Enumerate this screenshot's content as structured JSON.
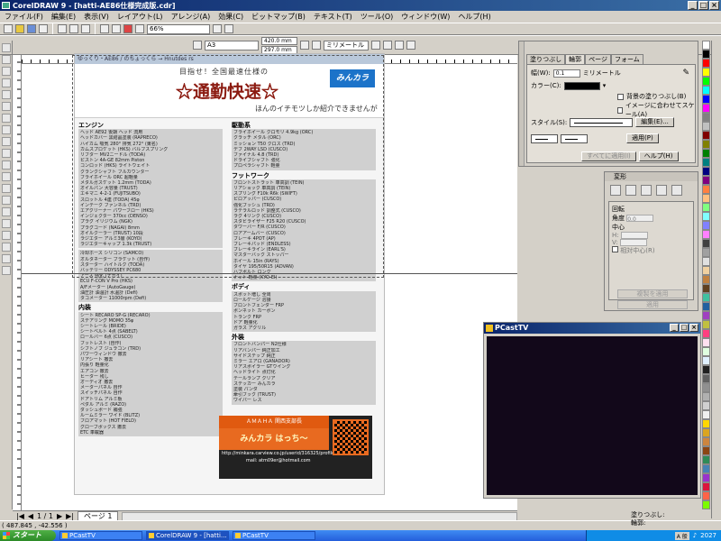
{
  "window": {
    "title": "CorelDRAW 9 - [hatti-AE86仕様完成版.cdr]"
  },
  "menubar": [
    "ファイル(F)",
    "編集(E)",
    "表示(V)",
    "レイアウト(L)",
    "アレンジ(A)",
    "効果(C)",
    "ビットマップ(B)",
    "テキスト(T)",
    "ツール(O)",
    "ウィンドウ(W)",
    "ヘルプ(H)"
  ],
  "toolbar": {
    "zoom": "66%",
    "paper_size": "A3",
    "width": "420.0 mm",
    "height": "297.0 mm",
    "units": "ミリメートル"
  },
  "doc": {
    "top_url": "ゆっくり・AE86 / のちょっくら → Hnutdes rs",
    "tagline": "目指せ！全国最速仕様の",
    "title": "☆通勤快速☆",
    "logo": "みんカラ",
    "subline": "ほんのイチモツしか紹介できませんが",
    "left_sections": [
      {
        "heading": "エンジン",
        "lines": [
          "ヘッド AE92 後期 ヘッド 流用",
          "ヘッドカバー 黒結晶塗装 (RAPRECO)",
          "ハイカム 吸気 280° 排気 272° (東名)",
          "カムスプロケット (HKS) バルブスプリング",
          "リフター MV2ニードル (TODA)",
          "ピストン 4A-GE 82mm Piston",
          "コンロッド (HKS) ライトウェイト",
          "クランクシャフト フルカウンター",
          "フライホイール ORC 超軽量",
          "メタルガスケット 1.2mm (TODA)",
          "オイルパン 大容量 (TRUST)",
          "エキマニ 4-2-1 (FUJITSUBO)",
          "スロットル 4連 (TODA) 45φ",
          "インテーク ファンネル (TRD)",
          "エアクリーナー パワーフロー (HKS)",
          "インジェクター 370cc (DENSO)",
          "プラグ イリジウム (NGK)",
          "プラグコード (NAGAI) 8mm",
          "オイルクーラー (TRUST) 10段",
          "ラジエター アルミ3層 (KOYO)",
          "ラジエターキャップ 1.3k (TRUST)"
        ]
      },
      {
        "heading": "",
        "lines": [
          "冷却ホース シリコン (SAMCO)",
          "オルタネーター ブラケット (自作)",
          "スターター ハイトルク (TODA)",
          "バッテリー ODYSSEY PC680",
          "アース 強化 (ナガイ)",
          "ECU F-CON V Pro (HKS)",
          "A/Fメーター (AutoGauge)",
          "油圧計 油温計 水温計 (Defi)",
          "タコメーター 11000rpm (Defi)"
        ]
      },
      {
        "heading": "内装",
        "lines": [
          "シート RECARO SP-G (RECARO)",
          "ステアリング MOMO 35φ",
          "シートレール (BRIDE)",
          "シートベルト 4点 (SABELT)",
          "ロールバー 6点 (CUSCO)",
          "フットレスト (自作)",
          "シフトノブ ジュラコン (TRD)",
          "パワーウィンドウ 撤去",
          "リアシート 撤去",
          "内張り 軽量化",
          "エアコン 撤去",
          "ヒーター 残し",
          "オーディオ 撤去",
          "メーターパネル 自作",
          "スイッチパネル 自作",
          "ドアトリム アルミ板",
          "ペダル アルミ (RAZO)",
          "ダッシュボード 補強",
          "ルームミラー ワイド (BLITZ)",
          "フロアマット (HOT FIELD)",
          "グローブボックス 撤去",
          "ETC 車載器"
        ]
      }
    ],
    "right_sections": [
      {
        "heading": "駆動系",
        "lines": [
          "フライホイール クロモリ 4.9kg (ORC)",
          "クラッチ メタル (ORC)",
          "ミッション T50 クロス (TRD)",
          "デフ 2WAY LSD (CUSCO)",
          "ファイナル 4.8 (TRD)",
          "ドライブシャフト 強化",
          "プロペラシャフト 軽量"
        ]
      },
      {
        "heading": "フットワーク",
        "lines": [
          "フロントストラット 車高調 (TEIN)",
          "リアショック 車高調 (TEIN)",
          "スプリング F10k R6k (SWIFT)",
          "ピロアッパー (CUSCO)",
          "強化ブッシュ (TRD)",
          "ラテラルロッド 調整式 (CUSCO)",
          "ラグ 4リンク (CUSCO)",
          "スタビライザー F25 R20 (CUSCO)",
          "タワーバー F/R (CUSCO)",
          "ロアアームバー (CUSCO)",
          "ブレーキ 4POT (AP)",
          "ブレーキパッド (ENDLESS)",
          "ブレーキライン (EARL'S)",
          "マスターバック ストッパー",
          "ホイール 15in (RAYS)",
          "タイヤ 195/50R15 (ADVAN)",
          "ハブボルト ロング",
          "ナット 軽量 (KYO-EI)"
        ]
      },
      {
        "heading": "ボディ",
        "lines": [
          "スポット増し 全周",
          "ロールケージ 溶接",
          "フロントフェンダー FRP",
          "ボンネット カーボン",
          "トランク FRP",
          "ドア 軽量化",
          "ガラス アクリル"
        ]
      },
      {
        "heading": "外装",
        "lines": [
          "フロントバンパー N2仕様",
          "リアバンパー 純正加工",
          "サイドステップ 純正",
          "ミラー エアロ (GANADOR)",
          "リアスポイラー GTウイング",
          "ヘッドライト 点灯化",
          "テールランプ クリア",
          "ステッカー みんカラ",
          "塗装 パンダ",
          "牽引フック (TRUST)",
          "ワイパー レス"
        ]
      }
    ],
    "ad": {
      "top": "ＡＭＡＨＡ 関西支部長",
      "mid": "みんカラ はっち～",
      "url": "http://minkara.carview.co.jp/userid/316325/profile/",
      "mail": "mail: atm09er@hotmail.com"
    }
  },
  "docker": {
    "tabs": [
      "塗りつぶし",
      "輪郭",
      "ページ",
      "フォーム"
    ],
    "width_label": "幅(W):",
    "width_value": "0.1",
    "width_unit": "ミリメートル",
    "color_label": "カラー(C):",
    "chk1": "背景の塗りつぶし(B)",
    "chk2": "イメージに合わせてスケール(A)",
    "style_label": "スタイル(S):",
    "edit_btn": "編集(E)...",
    "apply_btn": "適用(P)",
    "all_colors_btn": "すべてに適用(I)",
    "help_btn": "ヘルプ(H)"
  },
  "transform": {
    "title": "変形",
    "rotate_label": "回転",
    "angle_label": "角度",
    "angle_value": "0.0",
    "center_label": "中心",
    "h_label": "H:",
    "v_label": "V:",
    "relative_label": "相対中心(R)",
    "apply_dup": "複製を適用",
    "apply": "適用"
  },
  "pcast": {
    "title": "PCastTV"
  },
  "pagebar": {
    "page_of": "1 / 1",
    "tab": "ページ 1"
  },
  "status": {
    "coords": "( 487.845 , -42.556 )",
    "fill": "塗りつぶし:",
    "outline": "輪郭:"
  },
  "taskbar": {
    "start": "スタート",
    "tasks": [
      "PCastTV",
      "CorelDRAW 9 - [hatti...",
      "PCastTV"
    ],
    "ime": "A 般",
    "clock": "2027"
  },
  "palette_colors": [
    "#ffffff",
    "#000000",
    "#ff0000",
    "#ffff00",
    "#00ff00",
    "#00ffff",
    "#0000ff",
    "#ff00ff",
    "#808080",
    "#c0c0c0",
    "#800000",
    "#808000",
    "#008000",
    "#008080",
    "#000080",
    "#800080",
    "#ff8040",
    "#ffc080",
    "#80ff80",
    "#80ffff",
    "#8080ff",
    "#ff80ff",
    "#404040",
    "#a0a0a0",
    "#e0e0e0",
    "#f0d0a0",
    "#c08040",
    "#604020",
    "#40c0a0",
    "#2060a0",
    "#a040c0",
    "#c0c040",
    "#ff4080",
    "#ffe0f0",
    "#e0ffe0",
    "#e0f0ff",
    "#202020",
    "#606060",
    "#909090",
    "#b0b0b0",
    "#d0d0d0",
    "#f0f0f0",
    "#ffd700",
    "#daa520",
    "#cd853f",
    "#8b4513",
    "#2e8b57",
    "#4682b4",
    "#9932cc",
    "#dc143c",
    "#ff6347",
    "#7cfc00"
  ]
}
